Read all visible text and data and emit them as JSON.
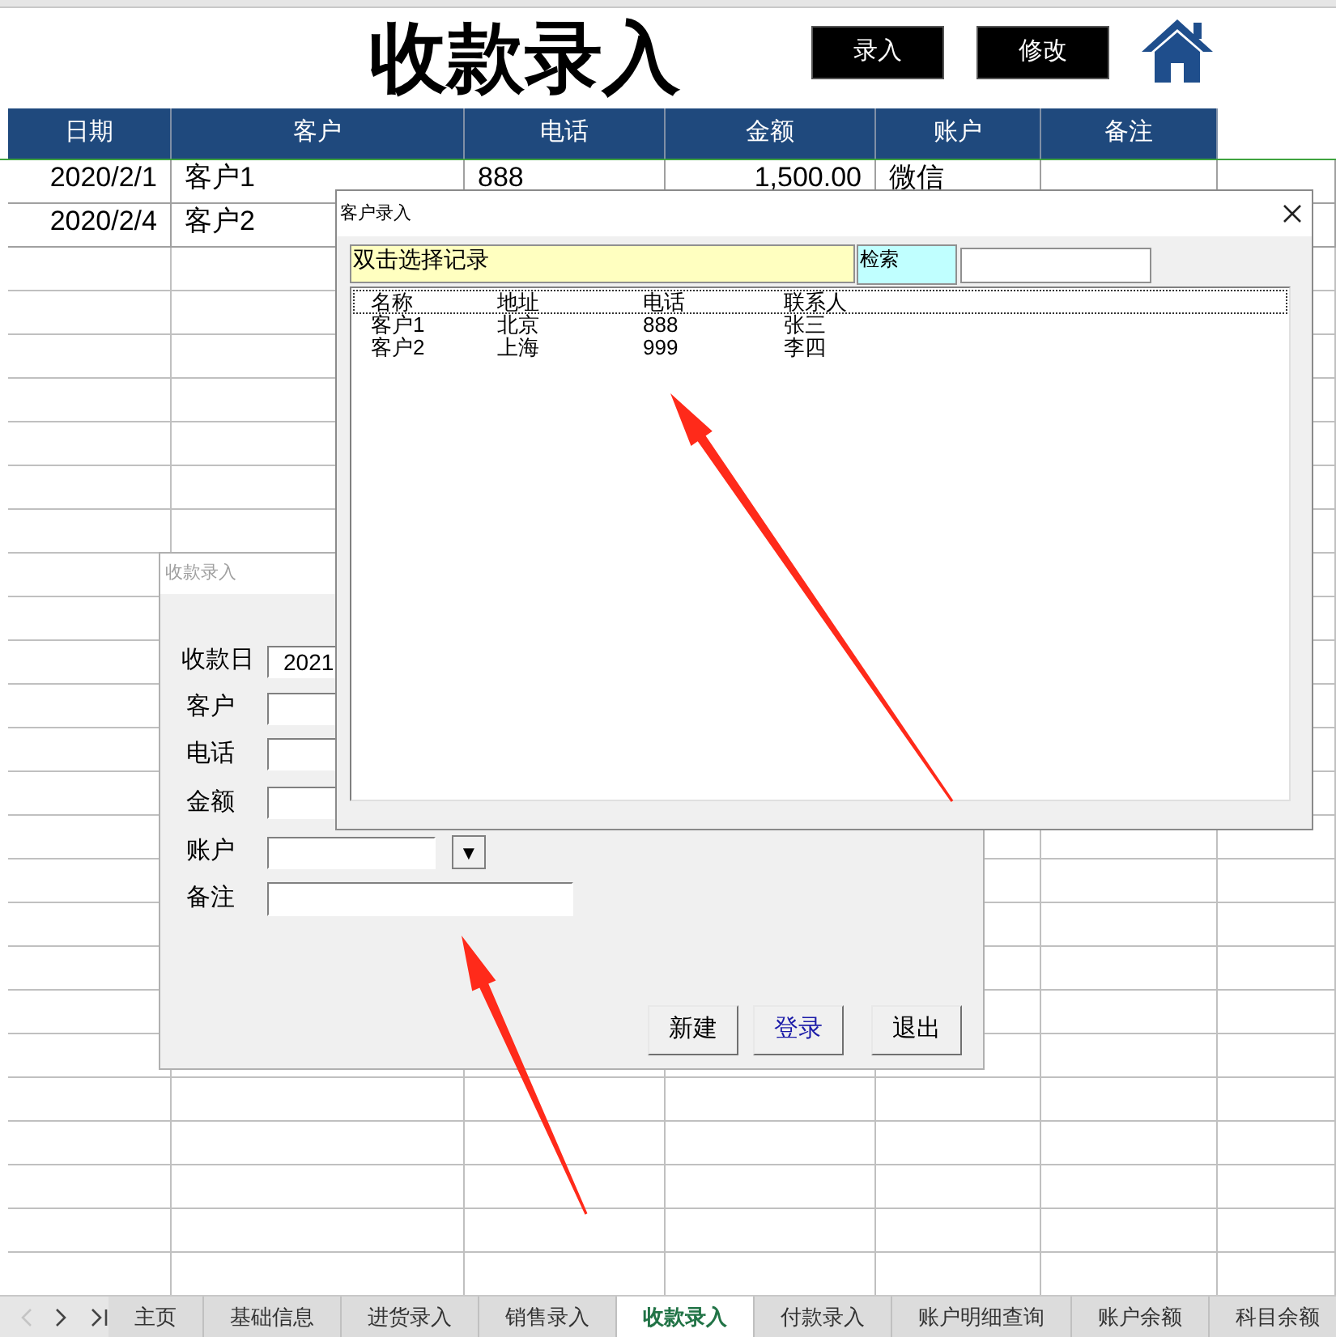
{
  "title": "收款录入",
  "toolbar_buttons": [
    "录入",
    "修改"
  ],
  "table": {
    "columns": [
      "日期",
      "客户",
      "电话",
      "金额",
      "账户",
      "备注"
    ],
    "rows": [
      {
        "date": "2020/2/1",
        "customer": "客户1",
        "phone": "888",
        "amount": "1,500.00",
        "account": "微信"
      },
      {
        "date": "2020/2/4",
        "customer": "客户2"
      }
    ]
  },
  "receipt_dialog": {
    "title": "收款录入",
    "fields": [
      {
        "label": "收款日",
        "kind": "text",
        "value": "2021"
      },
      {
        "label": "客户",
        "kind": "text"
      },
      {
        "label": "电话",
        "kind": "text"
      },
      {
        "label": "金额",
        "kind": "text"
      },
      {
        "label": "账户",
        "kind": "dropdown",
        "arrow": "▼"
      },
      {
        "label": "备注",
        "kind": "wide"
      }
    ],
    "buttons": [
      {
        "label": "新建",
        "focused": false
      },
      {
        "label": "登录",
        "focused": true
      },
      {
        "label": "退出",
        "focused": false
      }
    ]
  },
  "customer_dialog": {
    "title": "客户录入",
    "hint": "双击选择记录",
    "search_label": "检索",
    "list": {
      "columns": [
        "名称",
        "地址",
        "电话",
        "联系人"
      ],
      "rows": [
        [
          "客户1",
          "北京",
          "888",
          "张三"
        ],
        [
          "客户2",
          "上海",
          "999",
          "李四"
        ]
      ]
    }
  },
  "sheet_tabs": [
    {
      "label": "主页",
      "selected": false
    },
    {
      "label": "基础信息",
      "selected": false
    },
    {
      "label": "进货录入",
      "selected": false
    },
    {
      "label": "销售录入",
      "selected": false
    },
    {
      "label": "收款录入",
      "selected": true
    },
    {
      "label": "付款录入",
      "selected": false
    },
    {
      "label": "账户明细查询",
      "selected": false
    },
    {
      "label": "账户余额",
      "selected": false
    },
    {
      "label": "科目余额",
      "selected": false
    }
  ]
}
